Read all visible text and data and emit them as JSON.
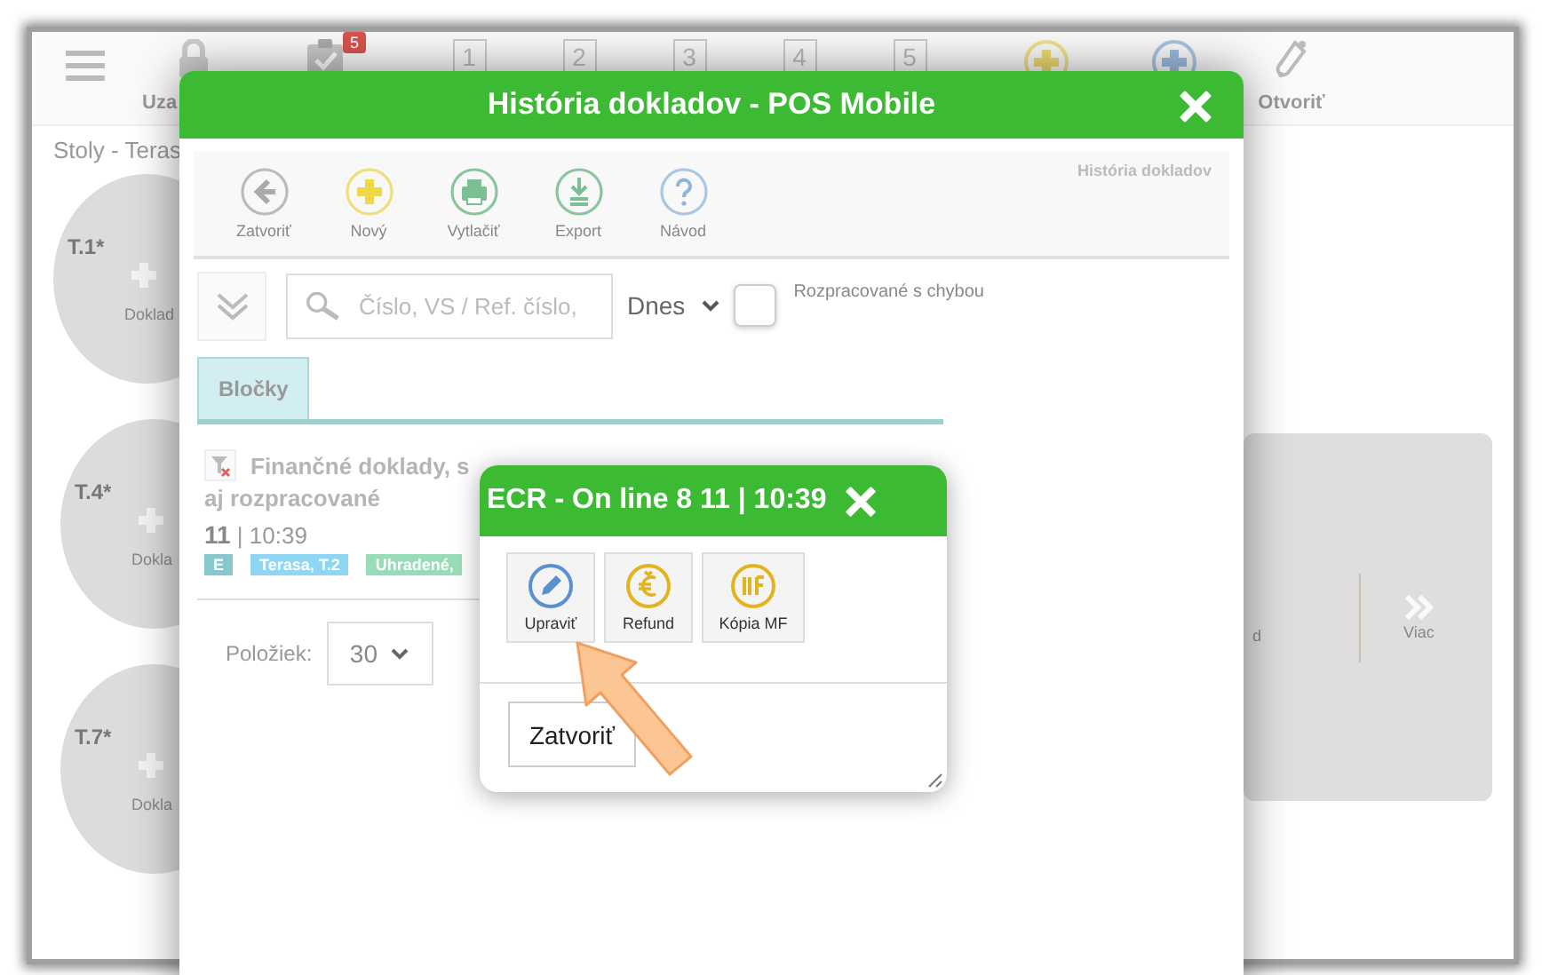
{
  "app_toolbar": {
    "items": [
      {
        "kind": "menu"
      },
      {
        "kind": "lock",
        "label": "Uza"
      },
      {
        "kind": "clipboard",
        "badge": "5"
      },
      {
        "kind": "number",
        "label": "1"
      },
      {
        "kind": "number",
        "label": "2"
      },
      {
        "kind": "number",
        "label": "3"
      },
      {
        "kind": "number",
        "label": "4"
      },
      {
        "kind": "number",
        "label": "5"
      },
      {
        "kind": "add-yellow"
      },
      {
        "kind": "add-blue"
      },
      {
        "kind": "bottle",
        "label": "Otvoriť"
      }
    ]
  },
  "breadcrumb": "Stoly - Teras",
  "tables": [
    {
      "name": "T.1*",
      "action": "Doklad"
    },
    {
      "name": "T.4*",
      "action": "Dokla"
    },
    {
      "name": "T.7*",
      "action": "Dokla"
    }
  ],
  "side_panel": {
    "text": "d",
    "more": "Viac"
  },
  "history_dialog": {
    "title": "História dokladov - POS Mobile",
    "section": "História dokladov",
    "tools": [
      {
        "kind": "back",
        "label": "Zatvoriť"
      },
      {
        "kind": "add",
        "label": "Nový"
      },
      {
        "kind": "print",
        "label": "Vytlačiť"
      },
      {
        "kind": "export",
        "label": "Export"
      },
      {
        "kind": "help",
        "label": "Návod"
      }
    ],
    "search_placeholder": "Číslo, VS / Ref. číslo,",
    "period": "Dnes",
    "error_filter": {
      "label": "Rozpracované s chybou",
      "checked": false
    },
    "tabs": [
      {
        "label": "Bločky",
        "selected": true
      }
    ],
    "documents": [
      {
        "title": "Finančné doklady, s",
        "subtitle": "aj rozpracované",
        "number_time": "**11** | 10:39",
        "tags": [
          {
            "text": "E",
            "color": "#86c8cb"
          },
          {
            "text": "Terasa, T.2",
            "color": "#8ed6f2"
          },
          {
            "text": "Uhradené,",
            "color": "#98ddb8"
          }
        ]
      }
    ],
    "page_size_label": "Položiek:",
    "page_size": "30"
  },
  "ecr_dialog": {
    "title": "ECR - On line 8 11 | 10:39",
    "actions": [
      {
        "kind": "edit",
        "label": "Upraviť"
      },
      {
        "kind": "euro",
        "label": "Refund"
      },
      {
        "kind": "lines",
        "label": "Kópia MF"
      }
    ],
    "close": "Zatvoriť"
  }
}
